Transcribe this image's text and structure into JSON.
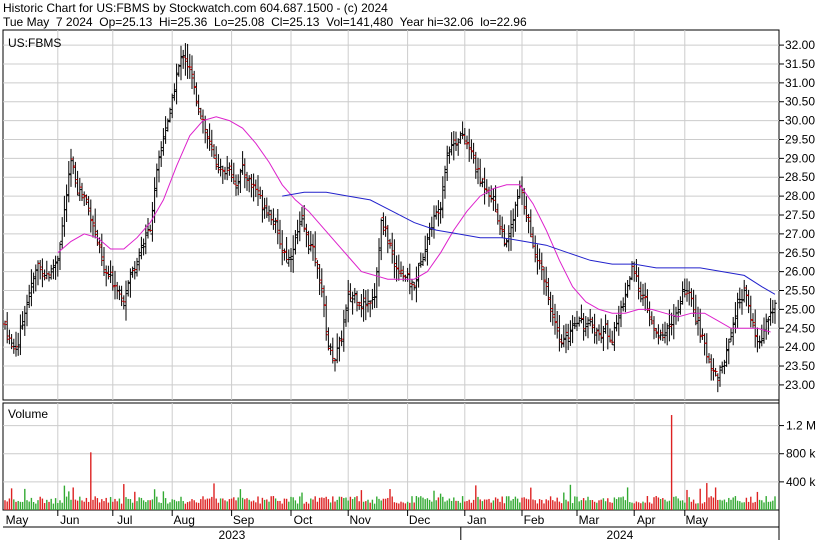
{
  "header": {
    "line1": "Historic Chart for US:FBMS by Stockwatch.com 604.687.1500 - (c) 2024",
    "line2": "Tue May  7 2024  Op=25.13  Hi=25.36  Lo=25.08  Cl=25.13  Vol=141,480  Year hi=32.06  lo=22.96"
  },
  "chart_data": {
    "type": "ohlc",
    "symbol": "US:FBMS",
    "ylim": [
      22.6,
      32.4
    ],
    "yticks": [
      23.0,
      23.5,
      24.0,
      24.5,
      25.0,
      25.5,
      26.0,
      26.5,
      27.0,
      27.5,
      28.0,
      28.5,
      29.0,
      29.5,
      30.0,
      30.5,
      31.0,
      31.5,
      32.0
    ],
    "month_labels": [
      "May",
      "Jun",
      "Jul",
      "Aug",
      "Sep",
      "Oct",
      "Nov",
      "Dec",
      "Jan",
      "Feb",
      "Mar",
      "Apr",
      "May"
    ],
    "year_labels": [
      "2023",
      "2024"
    ],
    "volume_panel": {
      "title": "Volume",
      "ticks": [
        "1.2 M",
        "800 k",
        "400 k"
      ],
      "tick_values": [
        1200000,
        800000,
        400000
      ]
    },
    "close_path": [
      [
        0,
        24.6
      ],
      [
        3,
        24.0
      ],
      [
        6,
        24.1
      ],
      [
        9,
        25.0
      ],
      [
        12,
        25.6
      ],
      [
        15,
        26.2
      ],
      [
        18,
        25.9
      ],
      [
        21,
        26.0
      ],
      [
        24,
        26.4
      ],
      [
        27,
        27.6
      ],
      [
        30,
        28.9
      ],
      [
        33,
        28.2
      ],
      [
        36,
        28.0
      ],
      [
        39,
        27.5
      ],
      [
        42,
        26.8
      ],
      [
        45,
        26.0
      ],
      [
        48,
        25.8
      ],
      [
        51,
        25.6
      ],
      [
        54,
        25.3
      ],
      [
        57,
        25.9
      ],
      [
        60,
        26.3
      ],
      [
        63,
        26.8
      ],
      [
        66,
        27.2
      ],
      [
        69,
        28.6
      ],
      [
        72,
        29.6
      ],
      [
        75,
        30.2
      ],
      [
        78,
        31.2
      ],
      [
        81,
        31.8
      ],
      [
        84,
        31.3
      ],
      [
        87,
        30.6
      ],
      [
        90,
        30.0
      ],
      [
        93,
        29.3
      ],
      [
        96,
        28.9
      ],
      [
        99,
        28.6
      ],
      [
        102,
        28.8
      ],
      [
        105,
        28.3
      ],
      [
        108,
        28.7
      ],
      [
        111,
        28.4
      ],
      [
        114,
        28.2
      ],
      [
        117,
        27.8
      ],
      [
        120,
        27.6
      ],
      [
        123,
        27.2
      ],
      [
        126,
        26.6
      ],
      [
        129,
        26.3
      ],
      [
        132,
        26.9
      ],
      [
        135,
        27.3
      ],
      [
        138,
        26.8
      ],
      [
        141,
        26.4
      ],
      [
        144,
        25.5
      ],
      [
        147,
        24.0
      ],
      [
        150,
        23.7
      ],
      [
        153,
        24.3
      ],
      [
        156,
        25.3
      ],
      [
        159,
        25.4
      ],
      [
        162,
        25.1
      ],
      [
        165,
        25.2
      ],
      [
        168,
        25.4
      ],
      [
        171,
        27.3
      ],
      [
        174,
        26.9
      ],
      [
        177,
        26.2
      ],
      [
        180,
        26.0
      ],
      [
        183,
        25.8
      ],
      [
        186,
        25.6
      ],
      [
        189,
        26.3
      ],
      [
        192,
        26.9
      ],
      [
        195,
        27.4
      ],
      [
        198,
        27.8
      ],
      [
        201,
        29.2
      ],
      [
        204,
        29.4
      ],
      [
        207,
        29.6
      ],
      [
        210,
        29.4
      ],
      [
        213,
        29.0
      ],
      [
        216,
        28.4
      ],
      [
        219,
        28.2
      ],
      [
        222,
        27.9
      ],
      [
        225,
        27.2
      ],
      [
        228,
        26.7
      ],
      [
        231,
        27.4
      ],
      [
        234,
        28.2
      ],
      [
        237,
        27.6
      ],
      [
        240,
        26.6
      ],
      [
        243,
        26.3
      ],
      [
        246,
        25.6
      ],
      [
        249,
        24.8
      ],
      [
        252,
        24.1
      ],
      [
        255,
        24.2
      ],
      [
        258,
        24.6
      ],
      [
        261,
        24.8
      ],
      [
        264,
        24.5
      ],
      [
        267,
        24.6
      ],
      [
        270,
        24.3
      ],
      [
        273,
        24.5
      ],
      [
        276,
        24.2
      ],
      [
        279,
        24.8
      ],
      [
        282,
        25.4
      ],
      [
        285,
        26.1
      ],
      [
        288,
        25.6
      ],
      [
        291,
        25.2
      ],
      [
        294,
        24.6
      ],
      [
        297,
        24.2
      ],
      [
        300,
        24.4
      ],
      [
        303,
        24.7
      ],
      [
        306,
        24.9
      ],
      [
        309,
        25.6
      ],
      [
        312,
        25.2
      ],
      [
        315,
        24.6
      ],
      [
        318,
        24.0
      ],
      [
        321,
        23.5
      ],
      [
        324,
        23.2
      ],
      [
        327,
        23.6
      ],
      [
        330,
        24.4
      ],
      [
        333,
        25.1
      ],
      [
        336,
        25.5
      ],
      [
        339,
        24.8
      ],
      [
        342,
        24.1
      ],
      [
        345,
        24.4
      ],
      [
        348,
        24.9
      ],
      [
        350,
        25.13
      ]
    ],
    "ma_short": [
      [
        24,
        26.5
      ],
      [
        30,
        26.8
      ],
      [
        36,
        27.0
      ],
      [
        42,
        26.9
      ],
      [
        48,
        26.6
      ],
      [
        54,
        26.6
      ],
      [
        60,
        26.9
      ],
      [
        66,
        27.3
      ],
      [
        72,
        27.9
      ],
      [
        78,
        28.8
      ],
      [
        84,
        29.6
      ],
      [
        90,
        30.0
      ],
      [
        96,
        30.1
      ],
      [
        102,
        30.0
      ],
      [
        108,
        29.8
      ],
      [
        114,
        29.4
      ],
      [
        120,
        28.9
      ],
      [
        126,
        28.3
      ],
      [
        132,
        27.9
      ],
      [
        138,
        27.6
      ],
      [
        144,
        27.2
      ],
      [
        150,
        26.8
      ],
      [
        156,
        26.4
      ],
      [
        162,
        26.0
      ],
      [
        168,
        25.9
      ],
      [
        174,
        25.8
      ],
      [
        180,
        25.8
      ],
      [
        186,
        25.8
      ],
      [
        192,
        26.0
      ],
      [
        198,
        26.5
      ],
      [
        204,
        27.1
      ],
      [
        210,
        27.6
      ],
      [
        216,
        28.0
      ],
      [
        222,
        28.2
      ],
      [
        228,
        28.3
      ],
      [
        234,
        28.3
      ],
      [
        240,
        27.8
      ],
      [
        246,
        27.1
      ],
      [
        252,
        26.3
      ],
      [
        258,
        25.6
      ],
      [
        264,
        25.2
      ],
      [
        270,
        25.0
      ],
      [
        276,
        24.9
      ],
      [
        282,
        24.9
      ],
      [
        288,
        25.0
      ],
      [
        294,
        25.0
      ],
      [
        300,
        24.9
      ],
      [
        306,
        24.8
      ],
      [
        312,
        24.9
      ],
      [
        318,
        24.9
      ],
      [
        324,
        24.7
      ],
      [
        330,
        24.5
      ],
      [
        336,
        24.5
      ],
      [
        342,
        24.5
      ],
      [
        348,
        24.4
      ]
    ],
    "ma_long": [
      [
        126,
        28.0
      ],
      [
        136,
        28.1
      ],
      [
        146,
        28.1
      ],
      [
        156,
        28.0
      ],
      [
        166,
        27.9
      ],
      [
        176,
        27.6
      ],
      [
        186,
        27.3
      ],
      [
        196,
        27.1
      ],
      [
        206,
        27.0
      ],
      [
        216,
        26.9
      ],
      [
        226,
        26.9
      ],
      [
        236,
        26.8
      ],
      [
        246,
        26.7
      ],
      [
        256,
        26.5
      ],
      [
        266,
        26.3
      ],
      [
        276,
        26.2
      ],
      [
        286,
        26.2
      ],
      [
        296,
        26.1
      ],
      [
        306,
        26.1
      ],
      [
        316,
        26.1
      ],
      [
        326,
        26.0
      ],
      [
        336,
        25.9
      ],
      [
        344,
        25.6
      ],
      [
        350,
        25.4
      ]
    ],
    "volume_spikes": [
      [
        39,
        820000
      ],
      [
        303,
        1350000
      ],
      [
        214,
        350000
      ]
    ]
  }
}
